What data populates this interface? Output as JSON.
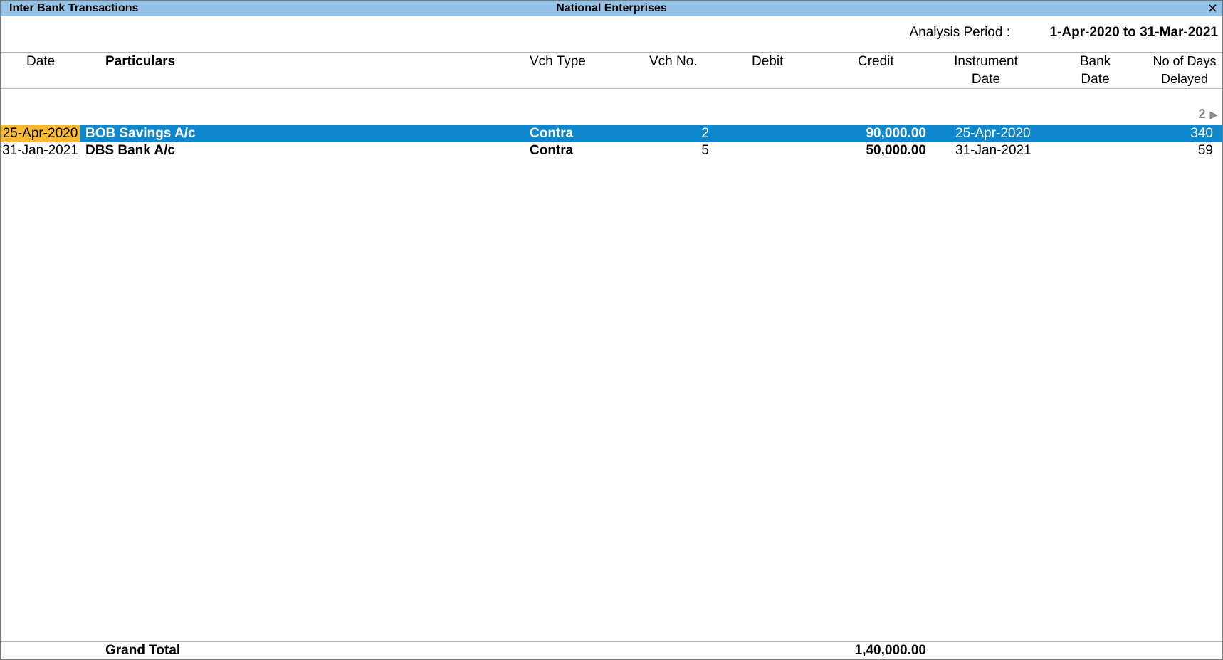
{
  "titlebar": {
    "left": "Inter Bank Transactions",
    "center": "National Enterprises",
    "close_glyph": "✕"
  },
  "period": {
    "label": "Analysis Period :",
    "value": "1-Apr-2020 to 31-Mar-2021"
  },
  "columns": {
    "date": "Date",
    "particulars": "Particulars",
    "vch_type": "Vch Type",
    "vch_no": "Vch No.",
    "debit": "Debit",
    "credit": "Credit",
    "instrument_1": "Instrument",
    "instrument_2": "Date",
    "bank_1": "Bank",
    "bank_2": "Date",
    "days_1": "No of Days",
    "days_2": "Delayed"
  },
  "pager": {
    "page": "2",
    "arrow": "▶"
  },
  "rows": [
    {
      "date": "25-Apr-2020",
      "particulars": "BOB Savings A/c",
      "vch_type": "Contra",
      "vch_no": "2",
      "debit": "",
      "credit": "90,000.00",
      "instrument_date": "25-Apr-2020",
      "bank_date": "",
      "days": "340"
    },
    {
      "date": "31-Jan-2021",
      "particulars": "DBS Bank A/c",
      "vch_type": "Contra",
      "vch_no": "5",
      "debit": "",
      "credit": "50,000.00",
      "instrument_date": "31-Jan-2021",
      "bank_date": "",
      "days": "59"
    }
  ],
  "total": {
    "label": "Grand Total",
    "credit": "1,40,000.00"
  },
  "colors": {
    "titlebar": "#93c2e6",
    "selected_row": "#0d88cf",
    "selected_date": "#f9b92a"
  }
}
